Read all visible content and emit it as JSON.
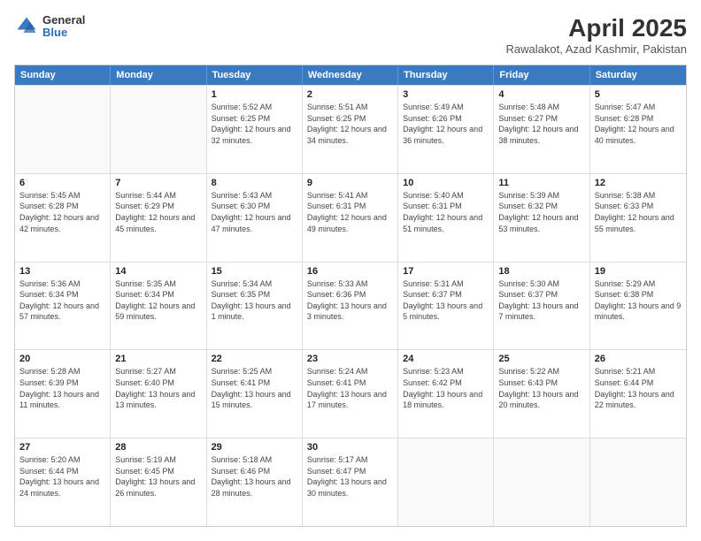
{
  "header": {
    "logo_general": "General",
    "logo_blue": "Blue",
    "main_title": "April 2025",
    "subtitle": "Rawalakot, Azad Kashmir, Pakistan"
  },
  "days": [
    "Sunday",
    "Monday",
    "Tuesday",
    "Wednesday",
    "Thursday",
    "Friday",
    "Saturday"
  ],
  "weeks": [
    [
      {
        "day": "",
        "sunrise": "",
        "sunset": "",
        "daylight": ""
      },
      {
        "day": "",
        "sunrise": "",
        "sunset": "",
        "daylight": ""
      },
      {
        "day": "1",
        "sunrise": "Sunrise: 5:52 AM",
        "sunset": "Sunset: 6:25 PM",
        "daylight": "Daylight: 12 hours and 32 minutes."
      },
      {
        "day": "2",
        "sunrise": "Sunrise: 5:51 AM",
        "sunset": "Sunset: 6:25 PM",
        "daylight": "Daylight: 12 hours and 34 minutes."
      },
      {
        "day": "3",
        "sunrise": "Sunrise: 5:49 AM",
        "sunset": "Sunset: 6:26 PM",
        "daylight": "Daylight: 12 hours and 36 minutes."
      },
      {
        "day": "4",
        "sunrise": "Sunrise: 5:48 AM",
        "sunset": "Sunset: 6:27 PM",
        "daylight": "Daylight: 12 hours and 38 minutes."
      },
      {
        "day": "5",
        "sunrise": "Sunrise: 5:47 AM",
        "sunset": "Sunset: 6:28 PM",
        "daylight": "Daylight: 12 hours and 40 minutes."
      }
    ],
    [
      {
        "day": "6",
        "sunrise": "Sunrise: 5:45 AM",
        "sunset": "Sunset: 6:28 PM",
        "daylight": "Daylight: 12 hours and 42 minutes."
      },
      {
        "day": "7",
        "sunrise": "Sunrise: 5:44 AM",
        "sunset": "Sunset: 6:29 PM",
        "daylight": "Daylight: 12 hours and 45 minutes."
      },
      {
        "day": "8",
        "sunrise": "Sunrise: 5:43 AM",
        "sunset": "Sunset: 6:30 PM",
        "daylight": "Daylight: 12 hours and 47 minutes."
      },
      {
        "day": "9",
        "sunrise": "Sunrise: 5:41 AM",
        "sunset": "Sunset: 6:31 PM",
        "daylight": "Daylight: 12 hours and 49 minutes."
      },
      {
        "day": "10",
        "sunrise": "Sunrise: 5:40 AM",
        "sunset": "Sunset: 6:31 PM",
        "daylight": "Daylight: 12 hours and 51 minutes."
      },
      {
        "day": "11",
        "sunrise": "Sunrise: 5:39 AM",
        "sunset": "Sunset: 6:32 PM",
        "daylight": "Daylight: 12 hours and 53 minutes."
      },
      {
        "day": "12",
        "sunrise": "Sunrise: 5:38 AM",
        "sunset": "Sunset: 6:33 PM",
        "daylight": "Daylight: 12 hours and 55 minutes."
      }
    ],
    [
      {
        "day": "13",
        "sunrise": "Sunrise: 5:36 AM",
        "sunset": "Sunset: 6:34 PM",
        "daylight": "Daylight: 12 hours and 57 minutes."
      },
      {
        "day": "14",
        "sunrise": "Sunrise: 5:35 AM",
        "sunset": "Sunset: 6:34 PM",
        "daylight": "Daylight: 12 hours and 59 minutes."
      },
      {
        "day": "15",
        "sunrise": "Sunrise: 5:34 AM",
        "sunset": "Sunset: 6:35 PM",
        "daylight": "Daylight: 13 hours and 1 minute."
      },
      {
        "day": "16",
        "sunrise": "Sunrise: 5:33 AM",
        "sunset": "Sunset: 6:36 PM",
        "daylight": "Daylight: 13 hours and 3 minutes."
      },
      {
        "day": "17",
        "sunrise": "Sunrise: 5:31 AM",
        "sunset": "Sunset: 6:37 PM",
        "daylight": "Daylight: 13 hours and 5 minutes."
      },
      {
        "day": "18",
        "sunrise": "Sunrise: 5:30 AM",
        "sunset": "Sunset: 6:37 PM",
        "daylight": "Daylight: 13 hours and 7 minutes."
      },
      {
        "day": "19",
        "sunrise": "Sunrise: 5:29 AM",
        "sunset": "Sunset: 6:38 PM",
        "daylight": "Daylight: 13 hours and 9 minutes."
      }
    ],
    [
      {
        "day": "20",
        "sunrise": "Sunrise: 5:28 AM",
        "sunset": "Sunset: 6:39 PM",
        "daylight": "Daylight: 13 hours and 11 minutes."
      },
      {
        "day": "21",
        "sunrise": "Sunrise: 5:27 AM",
        "sunset": "Sunset: 6:40 PM",
        "daylight": "Daylight: 13 hours and 13 minutes."
      },
      {
        "day": "22",
        "sunrise": "Sunrise: 5:25 AM",
        "sunset": "Sunset: 6:41 PM",
        "daylight": "Daylight: 13 hours and 15 minutes."
      },
      {
        "day": "23",
        "sunrise": "Sunrise: 5:24 AM",
        "sunset": "Sunset: 6:41 PM",
        "daylight": "Daylight: 13 hours and 17 minutes."
      },
      {
        "day": "24",
        "sunrise": "Sunrise: 5:23 AM",
        "sunset": "Sunset: 6:42 PM",
        "daylight": "Daylight: 13 hours and 18 minutes."
      },
      {
        "day": "25",
        "sunrise": "Sunrise: 5:22 AM",
        "sunset": "Sunset: 6:43 PM",
        "daylight": "Daylight: 13 hours and 20 minutes."
      },
      {
        "day": "26",
        "sunrise": "Sunrise: 5:21 AM",
        "sunset": "Sunset: 6:44 PM",
        "daylight": "Daylight: 13 hours and 22 minutes."
      }
    ],
    [
      {
        "day": "27",
        "sunrise": "Sunrise: 5:20 AM",
        "sunset": "Sunset: 6:44 PM",
        "daylight": "Daylight: 13 hours and 24 minutes."
      },
      {
        "day": "28",
        "sunrise": "Sunrise: 5:19 AM",
        "sunset": "Sunset: 6:45 PM",
        "daylight": "Daylight: 13 hours and 26 minutes."
      },
      {
        "day": "29",
        "sunrise": "Sunrise: 5:18 AM",
        "sunset": "Sunset: 6:46 PM",
        "daylight": "Daylight: 13 hours and 28 minutes."
      },
      {
        "day": "30",
        "sunrise": "Sunrise: 5:17 AM",
        "sunset": "Sunset: 6:47 PM",
        "daylight": "Daylight: 13 hours and 30 minutes."
      },
      {
        "day": "",
        "sunrise": "",
        "sunset": "",
        "daylight": ""
      },
      {
        "day": "",
        "sunrise": "",
        "sunset": "",
        "daylight": ""
      },
      {
        "day": "",
        "sunrise": "",
        "sunset": "",
        "daylight": ""
      }
    ]
  ]
}
